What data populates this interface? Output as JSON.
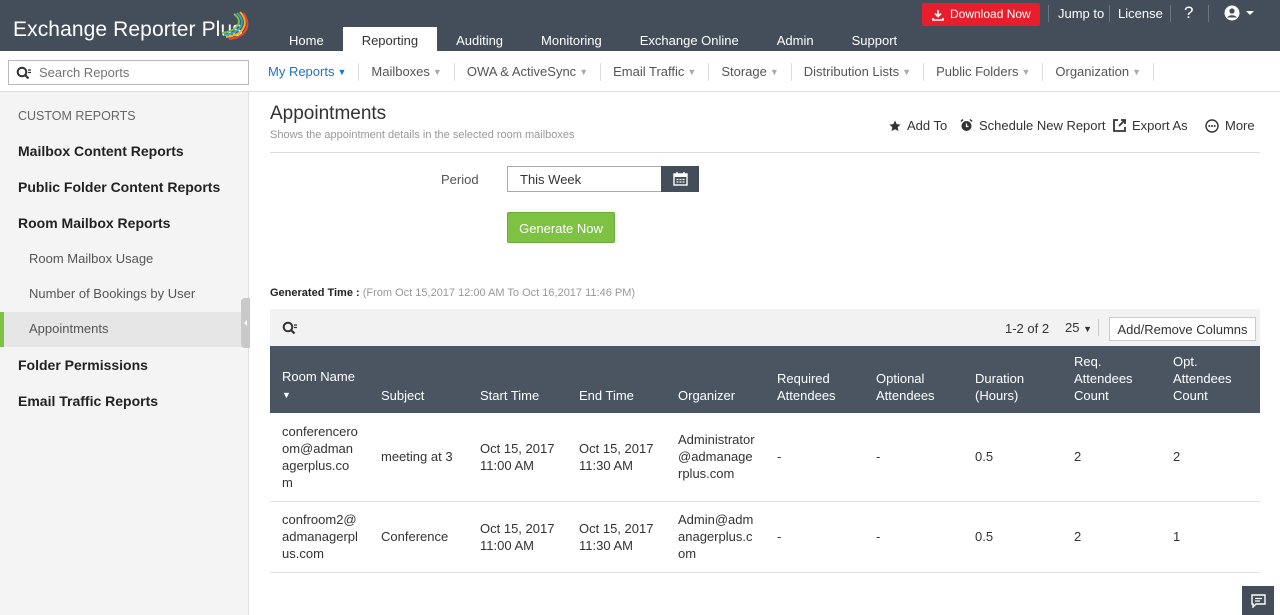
{
  "app": {
    "title": "Exchange Reporter Plus"
  },
  "topbar": {
    "tabs": [
      "Home",
      "Reporting",
      "Auditing",
      "Monitoring",
      "Exchange Online",
      "Admin",
      "Support"
    ],
    "download_label": "Download Now",
    "jump_to": "Jump to",
    "license": "License",
    "help": "?"
  },
  "search": {
    "placeholder": "Search Reports"
  },
  "subnav": [
    "My Reports",
    "Mailboxes",
    "OWA & ActiveSync",
    "Email Traffic",
    "Storage",
    "Distribution Lists",
    "Public Folders",
    "Organization"
  ],
  "sidebar": {
    "heading": "CUSTOM REPORTS",
    "items": [
      "Mailbox Content Reports",
      "Public Folder Content Reports",
      "Room Mailbox Reports",
      "Room Mailbox Usage",
      "Number of Bookings by User",
      "Appointments",
      "Folder Permissions",
      "Email Traffic Reports"
    ]
  },
  "report": {
    "title": "Appointments",
    "subtitle": "Shows the appointment details in the selected room mailboxes",
    "actions": {
      "add_to": "Add To",
      "schedule": "Schedule New Report",
      "export": "Export As",
      "more": "More"
    },
    "period_label": "Period",
    "period_value": "This Week",
    "generate": "Generate Now",
    "generated_label": "Generated Time :",
    "generated_value": "(From Oct 15,2017 12:00 AM To Oct 16,2017 11:46 PM)",
    "pager": "1-2 of 2",
    "page_size": "25",
    "add_remove": "Add/Remove Columns"
  },
  "table": {
    "columns": [
      "Room Name",
      "Subject",
      "Start Time",
      "End Time",
      "Organizer",
      "Required Attendees",
      "Optional Attendees",
      "Duration (Hours)",
      "Req. Attendees Count",
      "Opt. Attendees Count"
    ],
    "rows": [
      [
        "conferenceroom@admanagerplus.com",
        "meeting at 3",
        "Oct 15, 2017 11:00 AM",
        "Oct 15, 2017 11:30 AM",
        "Administrator@admanagerplus.com",
        "-",
        "-",
        "0.5",
        "2",
        "2"
      ],
      [
        "confroom2@admanagerplus.com",
        "Conference",
        "Oct 15, 2017 11:00 AM",
        "Oct 15, 2017 11:30 AM",
        "Admin@admanagerplus.com",
        "-",
        "-",
        "0.5",
        "2",
        "1"
      ]
    ]
  },
  "colors": {
    "topbar": "#434e5a",
    "accent_green": "#7dc243",
    "download_red": "#e81e2d",
    "link_blue": "#1e73c5"
  }
}
